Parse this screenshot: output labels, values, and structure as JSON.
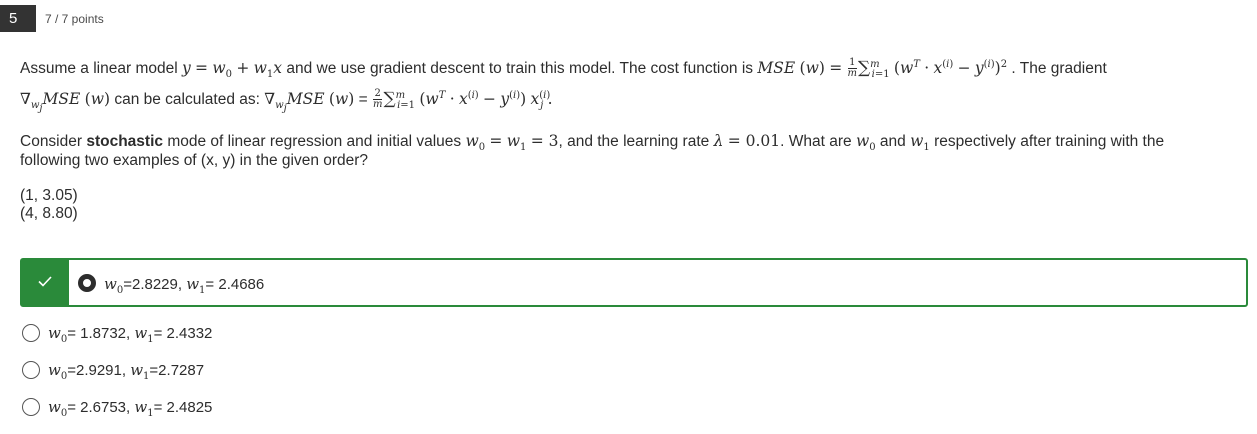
{
  "question": {
    "number": "5",
    "points": "7 / 7 points",
    "para1": {
      "t1": "Assume a linear model ",
      "t2": " and we use gradient descent to train this model. The cost function is ",
      "t3": ". The gradient",
      "t4": " can be calculated as: "
    },
    "para2": {
      "t1": "Consider ",
      "bold": "stochastic",
      "t2": " mode of linear regression and initial values ",
      "t3": ", and the learning rate ",
      "t4": ". What are ",
      "t5": " and ",
      "t6": " respectively after training with the",
      "t7": "following two examples of (x, y) in the given order?"
    },
    "pairs": [
      "(1, 3.05)",
      "(4, 8.80)"
    ]
  },
  "options": [
    {
      "w0": "=2.8229, ",
      "w1": "= 2.4686",
      "selected": true,
      "correct": true
    },
    {
      "w0": "= 1.8732, ",
      "w1": "= 2.4332",
      "selected": false,
      "correct": false
    },
    {
      "w0": "=2.9291, ",
      "w1": "=2.7287",
      "selected": false,
      "correct": false
    },
    {
      "w0": "= 2.6753, ",
      "w1": "= 2.4825",
      "selected": false,
      "correct": false
    }
  ],
  "colors": {
    "correct": "#2a8a3a",
    "badge": "#333333"
  },
  "icons": {
    "correct": "check-icon"
  }
}
